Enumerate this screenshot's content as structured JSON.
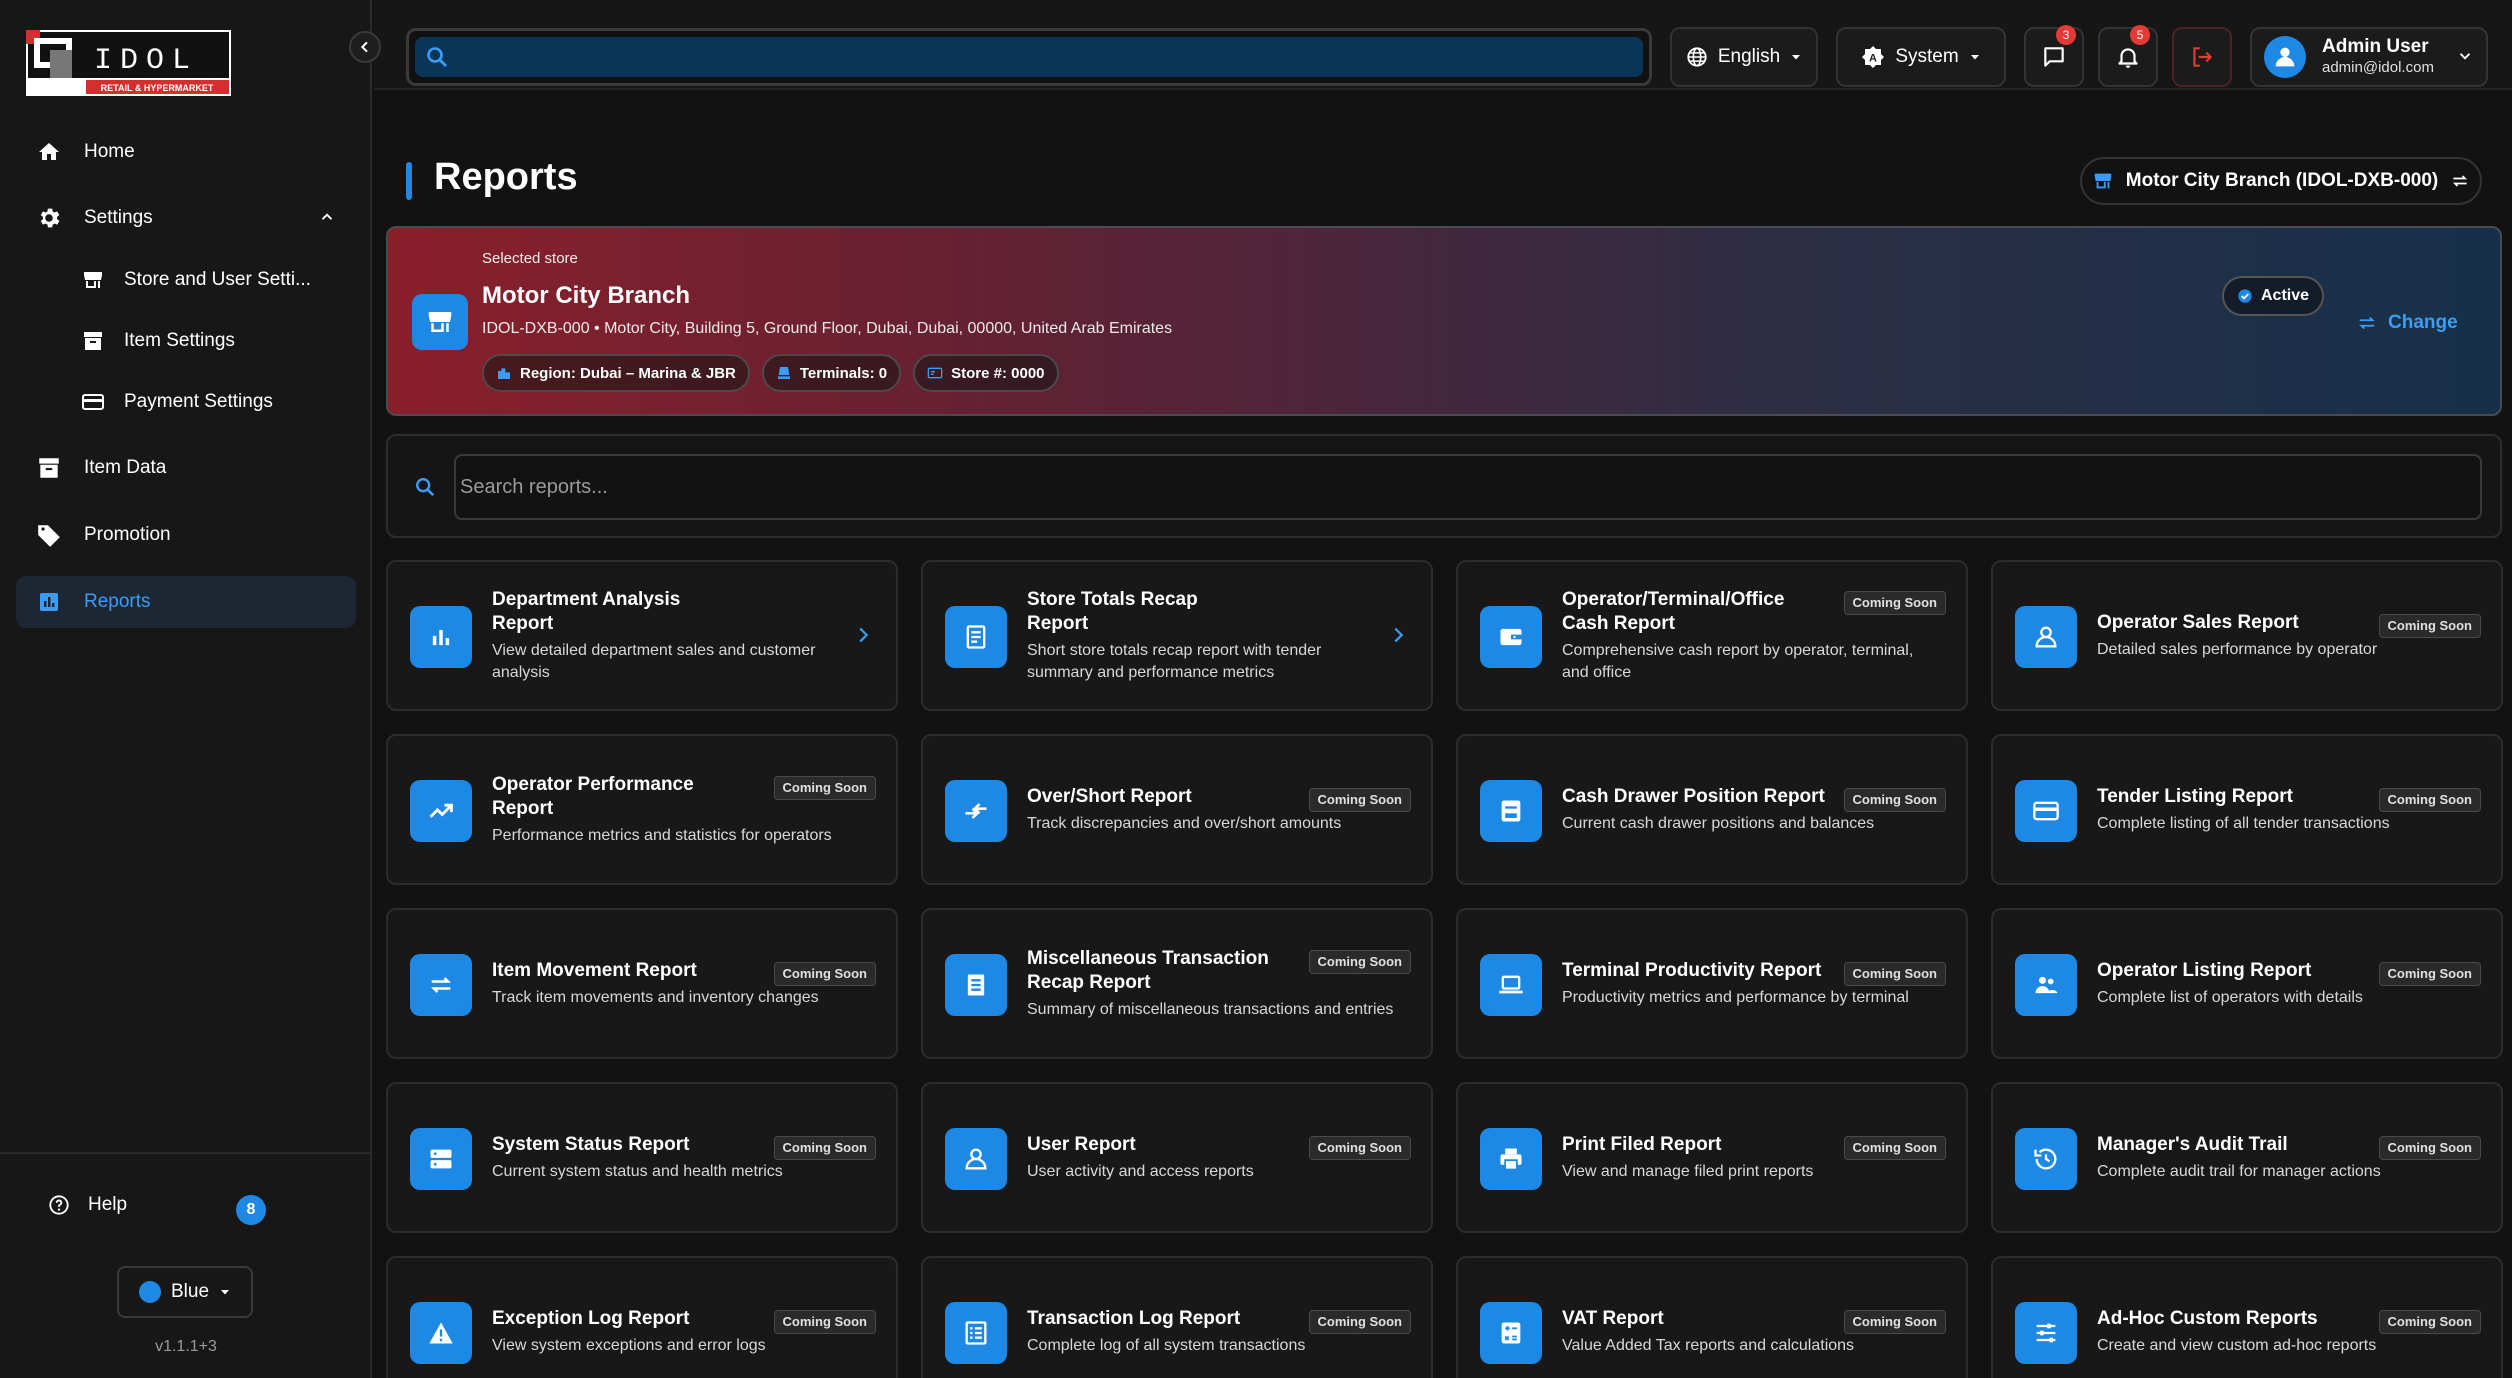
{
  "brand": {
    "logo_text": "IDOL",
    "logo_tagline": "RETAIL & HYPERMARKET",
    "accent": "#1e88e5"
  },
  "sidebar": {
    "items": [
      {
        "label": "Home",
        "icon": "home-icon"
      },
      {
        "label": "Settings",
        "icon": "gear-icon"
      },
      {
        "label": "Store and User Setti...",
        "icon": "store-icon"
      },
      {
        "label": "Item Settings",
        "icon": "archive-icon"
      },
      {
        "label": "Payment Settings",
        "icon": "credit-card-icon"
      },
      {
        "label": "Item Data",
        "icon": "archive-icon"
      },
      {
        "label": "Promotion",
        "icon": "tag-icon"
      },
      {
        "label": "Reports",
        "icon": "bar-chart-icon"
      }
    ],
    "help_label": "Help",
    "help_count": "8",
    "theme_label": "Blue",
    "version": "v1.1.1+3"
  },
  "topbar": {
    "search_placeholder": "",
    "language": "English",
    "theme_mode": "System",
    "messages_count": "3",
    "notifications_count": "5",
    "user_name": "Admin User",
    "user_email": "admin@idol.com"
  },
  "page": {
    "title": "Reports",
    "branch_selector": "Motor City Branch (IDOL-DXB-000)"
  },
  "store": {
    "overline": "Selected store",
    "name": "Motor City Branch",
    "address": "IDOL-DXB-000 • Motor City, Building 5, Ground Floor, Dubai, Dubai, 00000, United Arab Emirates",
    "region": "Region: Dubai – Marina & JBR",
    "terminals": "Terminals: 0",
    "store_number": "Store #: 0000",
    "status": "Active",
    "change_label": "Change"
  },
  "report_search": {
    "placeholder": "Search reports..."
  },
  "coming_soon_label": "Coming Soon",
  "reports": [
    {
      "title": "Department Analysis Report",
      "desc": "View detailed department sales and customer analysis",
      "icon": "bar-chart-icon",
      "available": true
    },
    {
      "title": "Store Totals Recap Report",
      "desc": "Short store totals recap report with tender summary and performance metrics",
      "icon": "receipt-icon",
      "available": true
    },
    {
      "title": "Operator/Terminal/Office Cash Report",
      "desc": "Comprehensive cash report by operator, terminal, and office",
      "icon": "wallet-icon",
      "available": false
    },
    {
      "title": "Operator Sales Report",
      "desc": "Detailed sales performance by operator",
      "icon": "person-icon",
      "available": false
    },
    {
      "title": "Operator Performance Report",
      "desc": "Performance metrics and statistics for operators",
      "icon": "trending-up-icon",
      "available": false
    },
    {
      "title": "Over/Short Report",
      "desc": "Track discrepancies and over/short amounts",
      "icon": "compare-arrows-icon",
      "available": false
    },
    {
      "title": "Cash Drawer Position Report",
      "desc": "Current cash drawer positions and balances",
      "icon": "drawer-icon",
      "available": false
    },
    {
      "title": "Tender Listing Report",
      "desc": "Complete listing of all tender transactions",
      "icon": "credit-card-icon",
      "available": false
    },
    {
      "title": "Item Movement Report",
      "desc": "Track item movements and inventory changes",
      "icon": "swap-icon",
      "available": false
    },
    {
      "title": "Miscellaneous Transaction Recap Report",
      "desc": "Summary of miscellaneous transactions and entries",
      "icon": "document-icon",
      "available": false
    },
    {
      "title": "Terminal Productivity Report",
      "desc": "Productivity metrics and performance by terminal",
      "icon": "laptop-icon",
      "available": false
    },
    {
      "title": "Operator Listing Report",
      "desc": "Complete list of operators with details",
      "icon": "group-icon",
      "available": false
    },
    {
      "title": "System Status Report",
      "desc": "Current system status and health metrics",
      "icon": "server-icon",
      "available": false
    },
    {
      "title": "User Report",
      "desc": "User activity and access reports",
      "icon": "person-icon",
      "available": false
    },
    {
      "title": "Print Filed Report",
      "desc": "View and manage filed print reports",
      "icon": "printer-icon",
      "available": false
    },
    {
      "title": "Manager's Audit Trail",
      "desc": "Complete audit trail for manager actions",
      "icon": "history-icon",
      "available": false
    },
    {
      "title": "Exception Log Report",
      "desc": "View system exceptions and error logs",
      "icon": "warning-icon",
      "available": false
    },
    {
      "title": "Transaction Log Report",
      "desc": "Complete log of all system transactions",
      "icon": "list-icon",
      "available": false
    },
    {
      "title": "VAT Report",
      "desc": "Value Added Tax reports and calculations",
      "icon": "calculator-icon",
      "available": false
    },
    {
      "title": "Ad-Hoc Custom Reports",
      "desc": "Create and view custom ad-hoc reports",
      "icon": "sliders-icon",
      "available": false
    }
  ]
}
